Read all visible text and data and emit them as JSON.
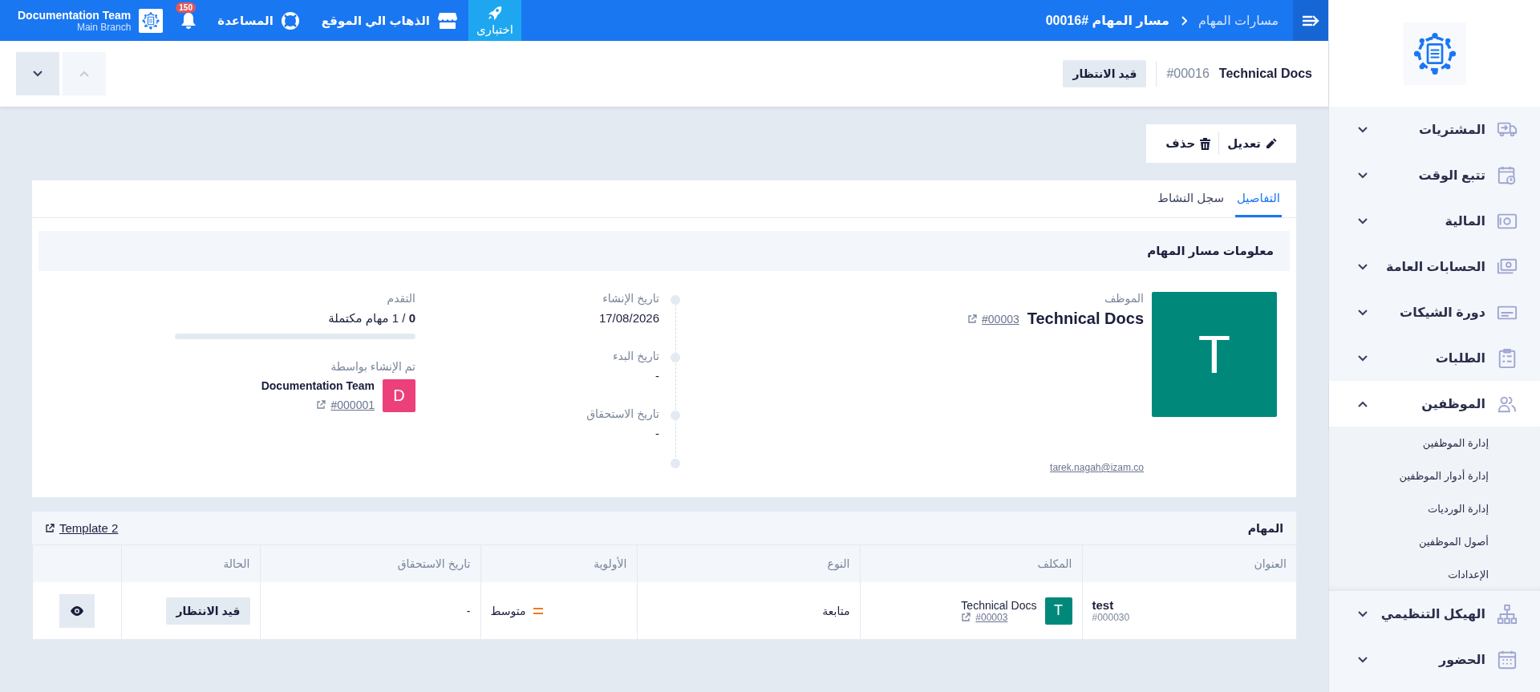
{
  "topbar": {
    "breadcrumb": [
      {
        "label": "مسارات المهام",
        "current": false
      },
      {
        "label": "مسار المهام #00016",
        "current": true
      }
    ],
    "actions": [
      {
        "kind": "test",
        "label": "اختباری"
      },
      {
        "kind": "site",
        "label": "الذهاب الي الموقع"
      },
      {
        "kind": "help",
        "label": "المساعدة"
      }
    ],
    "notifications": {
      "count": "150"
    },
    "account": {
      "name": "Documentation Team",
      "branch": "Main Branch"
    }
  },
  "header": {
    "title": "Technical Docs",
    "number": "#00016",
    "status": "قيد الانتظار",
    "nav": [
      {
        "kind": "up",
        "disabled": true
      },
      {
        "kind": "down",
        "disabled": false
      }
    ]
  },
  "actions": [
    {
      "kind": "edit",
      "label": "تعديل"
    },
    {
      "kind": "delete",
      "label": "حذف"
    }
  ],
  "tabs": [
    {
      "label": "التفاصيل",
      "selected": true
    },
    {
      "label": "سجل النشاط",
      "selected": false
    }
  ],
  "info": {
    "title": "معلومات مسار المهام",
    "employee": {
      "label": "الموظف",
      "avatar": "T",
      "color": "#00897b",
      "name": "Technical Docs",
      "code": "#00003",
      "email": "tarek.nagah@izam.co"
    },
    "dates": [
      {
        "label": "تاريخ الإنشاء",
        "value": "17/08/2026"
      },
      {
        "label": "تاريخ البدء",
        "value": "-"
      },
      {
        "label": "تاريخ الاستحقاق",
        "value": "-"
      }
    ],
    "progress": {
      "label": "التقدم",
      "text": "**0** / 1 مهام مكتملة",
      "level": 0
    },
    "created_by": {
      "label": "تم الإنشاء بواسطة",
      "avatar": "D",
      "color": "#ec407a",
      "name": "Documentation Team",
      "code": "#000001"
    }
  },
  "tasks": {
    "title": "المهام",
    "template": "Template 2",
    "columns": [
      "العنوان",
      "المكلف",
      "النوع",
      "الأولوية",
      "تاريخ الاستحقاق",
      "الحالة"
    ],
    "rows": [
      {
        "title": "test",
        "code": "#000030",
        "assignee": {
          "avatar": "T",
          "color": "#00897b",
          "name": "Technical Docs",
          "code": "#00003"
        },
        "type": "متابعة",
        "priority": "متوسط",
        "due": "-",
        "status": "قيد الانتظار"
      }
    ]
  },
  "sidebar": {
    "items": [
      {
        "label": "المشتريات",
        "kind": "truck",
        "expanded": false
      },
      {
        "label": "تتبع الوقت",
        "kind": "schedule",
        "expanded": false
      },
      {
        "label": "المالية",
        "kind": "safe",
        "expanded": false
      },
      {
        "label": "الحسابات العامة",
        "kind": "money",
        "expanded": false
      },
      {
        "label": "دورة الشيكات",
        "kind": "card",
        "expanded": false
      },
      {
        "label": "الطلبات",
        "kind": "clipboard",
        "expanded": false
      },
      {
        "label": "الموظفين",
        "kind": "users",
        "expanded": true,
        "children": [
          {
            "label": "إدارة الموظفين"
          },
          {
            "label": "إدارة أدوار الموظفين"
          },
          {
            "label": "إدارة الورديات"
          },
          {
            "label": "أصول الموظفين"
          },
          {
            "label": "الإعدادات"
          }
        ]
      },
      {
        "label": "الهيكل التنظيمي",
        "kind": "hierarchy",
        "expanded": false
      },
      {
        "label": "الحضور",
        "kind": "calendar",
        "expanded": false
      }
    ]
  }
}
